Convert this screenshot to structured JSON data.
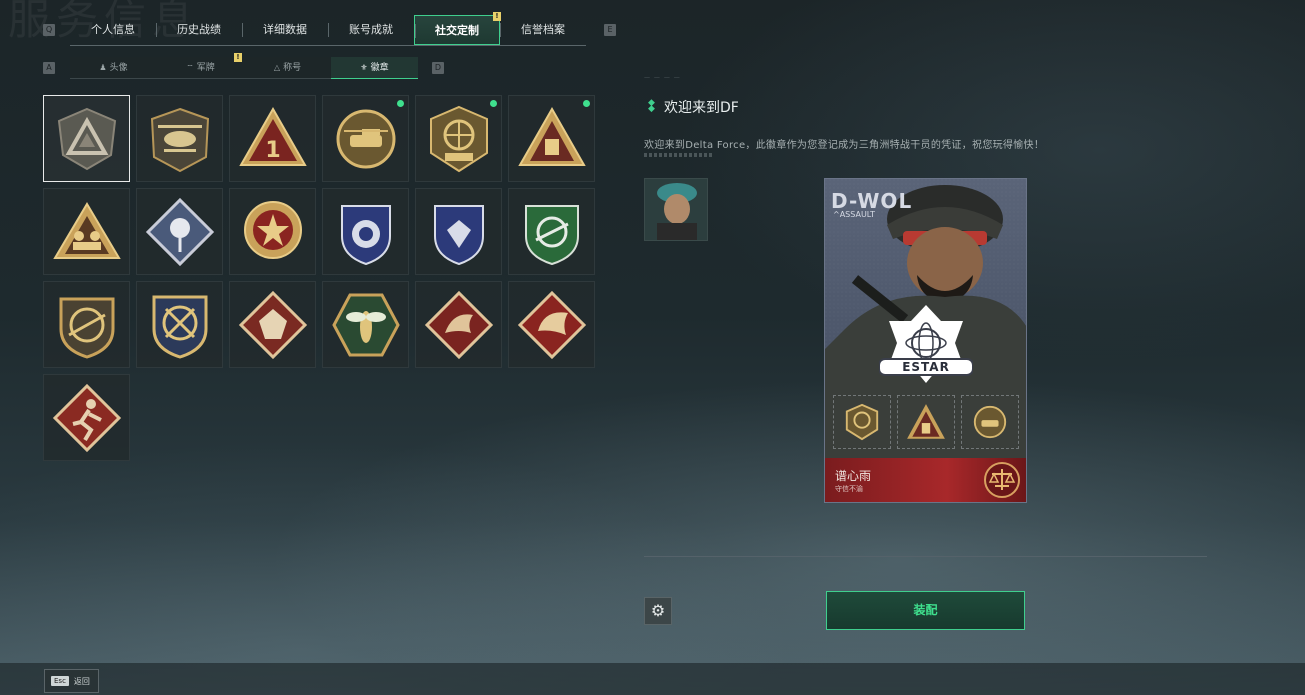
{
  "background_title": "服务信息",
  "top_tabs": {
    "left_key": "Q",
    "right_key": "E",
    "items": [
      {
        "label": "个人信息"
      },
      {
        "label": "历史战绩"
      },
      {
        "label": "详细数据"
      },
      {
        "label": "账号成就"
      },
      {
        "label": "社交定制",
        "active": true,
        "notice": "!"
      },
      {
        "label": "信誉档案"
      }
    ]
  },
  "sub_tabs": {
    "left_key": "A",
    "right_key": "D",
    "items": [
      {
        "label": "头像",
        "icon": "person-icon"
      },
      {
        "label": "军牌",
        "icon": "dogtag-icon",
        "notice": "!"
      },
      {
        "label": "称号",
        "icon": "triangle-icon"
      },
      {
        "label": "徽章",
        "icon": "badge-icon",
        "active": true
      }
    ]
  },
  "badges": [
    {
      "icon": "delta-triangle-badge",
      "selected": true
    },
    {
      "icon": "helicopter-badge"
    },
    {
      "icon": "number-one-triangle-badge"
    },
    {
      "icon": "delta-force-tank-badge",
      "new": true
    },
    {
      "icon": "delta-force-2026-badge",
      "new": true
    },
    {
      "icon": "triangle-crate-badge",
      "new": true
    },
    {
      "icon": "soldiers-triangle-badge"
    },
    {
      "icon": "rose-diamond-badge"
    },
    {
      "icon": "star-medal-badge"
    },
    {
      "icon": "blue-shield-badge"
    },
    {
      "icon": "blue-gem-shield-badge"
    },
    {
      "icon": "green-rifle-shield-badge"
    },
    {
      "icon": "rifle-shield-badge"
    },
    {
      "icon": "crossed-swords-badge"
    },
    {
      "icon": "wolf-diamond-badge"
    },
    {
      "icon": "wasp-hexagon-badge"
    },
    {
      "icon": "dragon-diamond-badge"
    },
    {
      "icon": "dragon-diamond-red-badge"
    },
    {
      "icon": "runner-diamond-badge"
    }
  ],
  "detail": {
    "title": "欢迎来到DF",
    "description": "欢迎来到Delta Force，此徽章作为您登记成为三角洲特战干员的凭证，祝您玩得愉快！"
  },
  "card": {
    "operator": "D-WOL",
    "class": "ASSAULT",
    "team_logo": "ESTAR",
    "player_name": "谱心雨",
    "player_subtitle": "守信不渝"
  },
  "equip_label": "装配",
  "back": {
    "key": "Esc",
    "label": "返回"
  },
  "colors": {
    "accent": "#3fcf8e",
    "card_red": "#a8282a",
    "gold": "#c9a25a"
  }
}
